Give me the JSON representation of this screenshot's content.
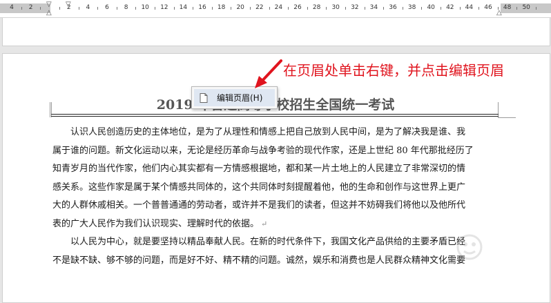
{
  "ruler": {
    "numbers": [
      "4",
      "2",
      "",
      "2",
      "4",
      "6",
      "8",
      "10",
      "12",
      "14",
      "16",
      "18",
      "20",
      "22",
      "24",
      "26",
      "28",
      "30",
      "32",
      "34",
      "36",
      "38",
      "40",
      "42",
      "44",
      "46",
      "48",
      "50"
    ]
  },
  "context_menu": {
    "items": [
      {
        "label": "编辑页眉(H)",
        "icon": "document-icon"
      }
    ]
  },
  "annotation": {
    "text": "在页眉处单击右键，并点击编辑页眉",
    "color": "#e0141e"
  },
  "document": {
    "header_title": "2019 年普通高等学校招生全国统一考试",
    "lines": [
      "认识人民创造历史的主体地位，是为了从理性和情感上把自己放到人民中间，是为了解决我是谁、我",
      "属于谁的问题。新文化运动以来，无论是经历革命与战争考验的现代作家，还是上世纪 80 年代那批经历了",
      "知青岁月的当代作家，他们内心其实都有一方情感根据地，都和某一片土地上的人民建立了非常深切的情",
      "感关系。这些作家是属于某个情感共同体的，这个共同体时刻提醒着他，他的生命和创作与这世界上更广",
      "大的人群休戚相关。一个普普通通的劳动者，或许并不是我们的读者，但这并不妨碍我们将他以及他所代",
      "表的广大人民作为我们认识现实、理解时代的依据。",
      "以人民为中心，就是要坚持以精品奉献人民。在新的时代条件下，我国文化产品供给的主要矛盾已经",
      "不是缺不缺、够不够的问题，而是好不好、精不精的问题。诚然，娱乐和消费也是人民群众精神文化需要"
    ],
    "paragraph_mark": "↵"
  }
}
